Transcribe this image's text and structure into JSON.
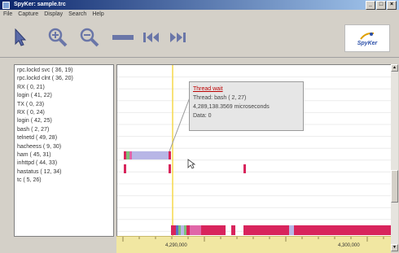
{
  "window": {
    "title": "SpyKer: sample.trc",
    "min": "_",
    "max": "□",
    "close": "×"
  },
  "menu": [
    "File",
    "Capture",
    "Display",
    "Search",
    "Help"
  ],
  "toolbar": {
    "buttons": [
      "pointer-icon",
      "zoom-in-icon",
      "zoom-out-icon",
      "bar-icon",
      "rewind-icon",
      "fast-forward-icon"
    ],
    "logo_text": "SpyKer"
  },
  "processes": [
    "rpc.lockd svc ( 36, 19)",
    "rpc.lockd clnt ( 36, 20)",
    "RX ( 0, 21)",
    "login ( 41, 22)",
    "TX ( 0, 23)",
    "RX ( 0, 24)",
    "login ( 42, 25)",
    "bash ( 2, 27)",
    "telnetd ( 49, 28)",
    "hacheess ( 9, 30)",
    "ham ( 45, 31)",
    "inhttpd ( 44, 33)",
    "hastatus ( 12, 34)",
    "tc ( 5, 26)"
  ],
  "tooltip": {
    "title": "Thread wait",
    "thread": "Thread: bash ( 2, 27)",
    "time": "4,289,138.3569 microseconds",
    "data": "Data: 0"
  },
  "timeline": {
    "ticks": [
      "4,290,000",
      "4,300,000"
    ]
  },
  "colors": {
    "marker": "#f5d84a",
    "event_red": "#d8245c",
    "event_pink": "#e066a8",
    "event_lavender": "#b8b6e6",
    "event_blue": "#5a70c8",
    "event_green": "#7ec07a",
    "axis_bg": "#f1e7a2"
  }
}
